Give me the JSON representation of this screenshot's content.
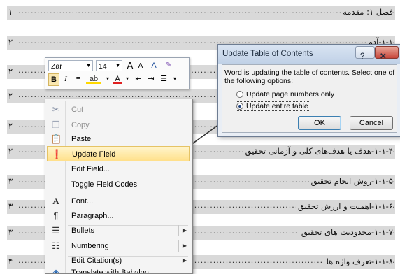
{
  "toc": {
    "entries": [
      {
        "text": "فصل ۱: مقدمه",
        "page": "۱"
      },
      {
        "text": "۱-۱-آدم",
        "page": "۲"
      },
      {
        "text": "",
        "page": "۲"
      },
      {
        "text": "",
        "page": "۲"
      },
      {
        "text": "",
        "page": "۲"
      },
      {
        "text": "",
        "page": "۲"
      },
      {
        "text": "۱-۱-۴-هدف یا هدف‌های کلی و آزمانی تحقیق",
        "page": "۲"
      },
      {
        "text": "۱-۱-۵-روش انجام تحقیق",
        "page": "۳"
      },
      {
        "text": "۱-۱-۶-اهمیت و ارزش تحقیق",
        "page": "۳"
      },
      {
        "text": "۱-۱-۷-محدودیت های تحقیق",
        "page": "۳"
      },
      {
        "text": "۱-۱-۸-تعرف واژه ها",
        "page": "۴"
      }
    ]
  },
  "mini_toolbar": {
    "font_name": "Zar",
    "font_size": "14",
    "grow_font": "A",
    "shrink_font": "A",
    "bold": "B",
    "italic": "I"
  },
  "context_menu": {
    "items": [
      {
        "label": "Cut",
        "icon": "scissors-icon",
        "disabled": true
      },
      {
        "label": "Copy",
        "icon": "copy-icon",
        "disabled": true
      },
      {
        "label": "Paste",
        "icon": "paste-icon",
        "disabled": false
      },
      {
        "label": "Update Field",
        "icon": "update-field-icon",
        "disabled": false,
        "highlighted": true
      },
      {
        "label": "Edit Field...",
        "icon": "",
        "disabled": false
      },
      {
        "label": "Toggle Field Codes",
        "icon": "",
        "disabled": false
      },
      {
        "label": "Font...",
        "icon": "font-icon",
        "disabled": false
      },
      {
        "label": "Paragraph...",
        "icon": "paragraph-icon",
        "disabled": false
      },
      {
        "label": "Bullets",
        "icon": "bullets-icon",
        "disabled": false,
        "submenu": true
      },
      {
        "label": "Numbering",
        "icon": "numbering-icon",
        "disabled": false,
        "submenu": true
      },
      {
        "label": "Edit Citation(s)",
        "icon": "",
        "disabled": false,
        "submenu": true
      },
      {
        "label": "Translate with Babylon",
        "icon": "babylon-icon",
        "disabled": false
      }
    ]
  },
  "dialog": {
    "title": "Update Table of Contents",
    "message": "Word is updating the table of contents.  Select one of the following options:",
    "option_1": "Update page numbers only",
    "option_2": "Update entire table",
    "selected": "Update entire table",
    "ok_label": "OK",
    "cancel_label": "Cancel",
    "help_glyph": "?",
    "close_glyph": "✕"
  }
}
